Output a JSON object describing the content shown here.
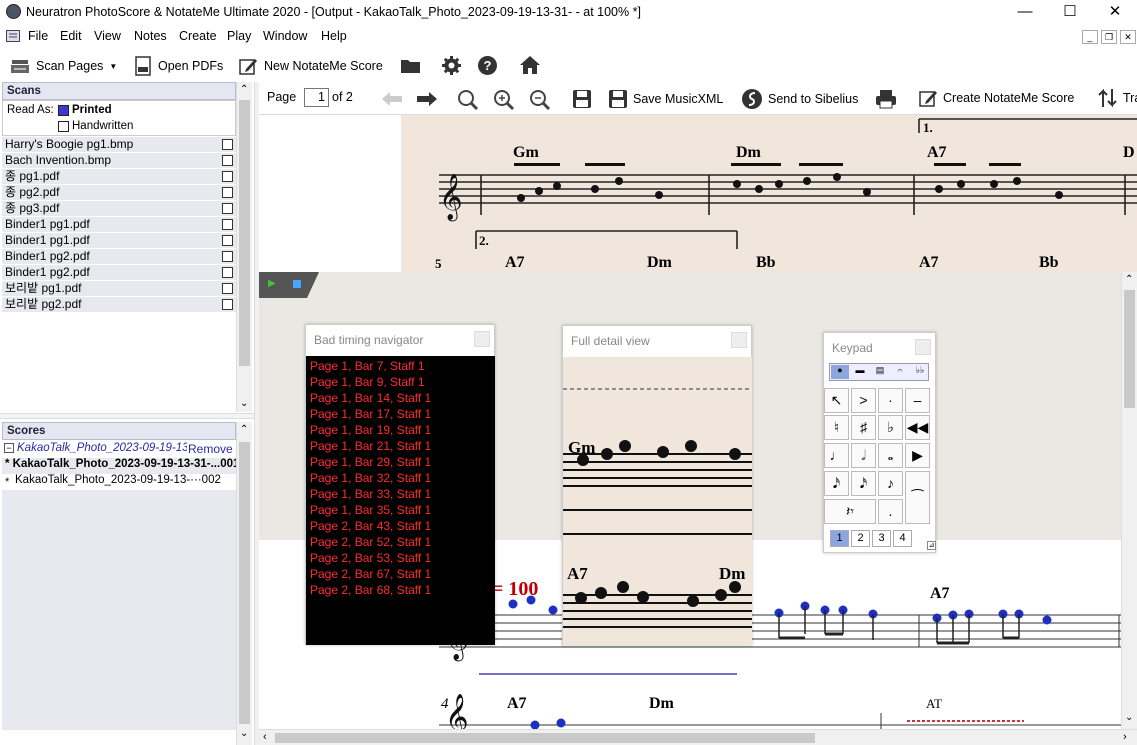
{
  "window": {
    "title": "Neuratron PhotoScore & NotateMe Ultimate 2020 - [Output - KakaoTalk_Photo_2023-09-19-13-31- - at 100% *]",
    "minimize_glyph": "—",
    "maximize_glyph": "☐",
    "close_glyph": "✕"
  },
  "menu": [
    "File",
    "Edit",
    "View",
    "Notes",
    "Create",
    "Play",
    "Window",
    "Help"
  ],
  "main_toolbar": {
    "scan_pages": "Scan Pages",
    "open_pdfs": "Open PDFs",
    "new_notateme_score": "New NotateMe Score"
  },
  "scans_pane": {
    "title": "Scans",
    "read_as_label": "Read As:",
    "printed_label": "Printed",
    "handwritten_label": "Handwritten",
    "files": [
      "Harry's Boogie pg1.bmp",
      "Bach Invention.bmp",
      "종 pg1.pdf",
      "종 pg2.pdf",
      "종 pg3.pdf",
      "Binder1 pg1.pdf",
      "Binder1 pg1.pdf",
      "Binder1 pg2.pdf",
      "Binder1 pg2.pdf",
      "보리밭 pg1.pdf",
      "보리밭 pg2.pdf"
    ]
  },
  "scores_pane": {
    "title": "Scores",
    "group_name": "KakaoTalk_Photo_2023-09-19-13-31",
    "remove_label": "Remove",
    "items": [
      "* KakaoTalk_Photo_2023-09-19-13-31-...001",
      "KakaoTalk_Photo_2023-09-19-13-···002"
    ]
  },
  "doc_toolbar": {
    "page_label": "Page",
    "page_number": "1",
    "page_of": "of 2",
    "save_musicxml": "Save MusicXML",
    "send_to_sibelius": "Send to Sibelius",
    "create_notateme_score": "Create NotateMe Score",
    "transpose_label": "Tra"
  },
  "scan_strip": {
    "chords_row1": [
      "Gm",
      "Dm",
      "A7",
      "D"
    ],
    "ending1": "1.",
    "ending2": "2.",
    "chords_row2": [
      "A7",
      "Dm",
      "Bb",
      "A7",
      "Bb"
    ],
    "bar_number": "5"
  },
  "score": {
    "tempo_text": "= 100",
    "chords": [
      "A7"
    ],
    "bar_number": "4",
    "row2_chords": [
      "A7",
      "Dm"
    ],
    "row2_marker": "AT"
  },
  "timing_navigator": {
    "title": "Bad timing navigator",
    "items": [
      "Page 1, Bar 7, Staff 1",
      "Page 1, Bar 9, Staff 1",
      "Page 1, Bar 14, Staff 1",
      "Page 1, Bar 17, Staff 1",
      "Page 1, Bar 19, Staff 1",
      "Page 1, Bar 21, Staff 1",
      "Page 1, Bar 29, Staff 1",
      "Page 1, Bar 32, Staff 1",
      "Page 1, Bar 33, Staff 1",
      "Page 1, Bar 35, Staff 1",
      "Page 2, Bar 43, Staff 1",
      "Page 2, Bar 52, Staff 1",
      "Page 2, Bar 53, Staff 1",
      "Page 2, Bar 67, Staff 1",
      "Page 2, Bar 68, Staff 1"
    ]
  },
  "full_detail": {
    "title": "Full detail view",
    "chord_top": "Gm",
    "chord_a7": "A7",
    "chord_dm": "Dm"
  },
  "keypad": {
    "title": "Keypad",
    "layouts": [
      "1",
      "2",
      "3",
      "4"
    ],
    "active_layout": "1"
  },
  "colors": {
    "error_text": "#ff2b2b",
    "note_blue": "#1f2fbf",
    "tempo_red": "#c00000",
    "pane_header": "#e4e6f2",
    "scan_paper": "#f1e6dc"
  }
}
